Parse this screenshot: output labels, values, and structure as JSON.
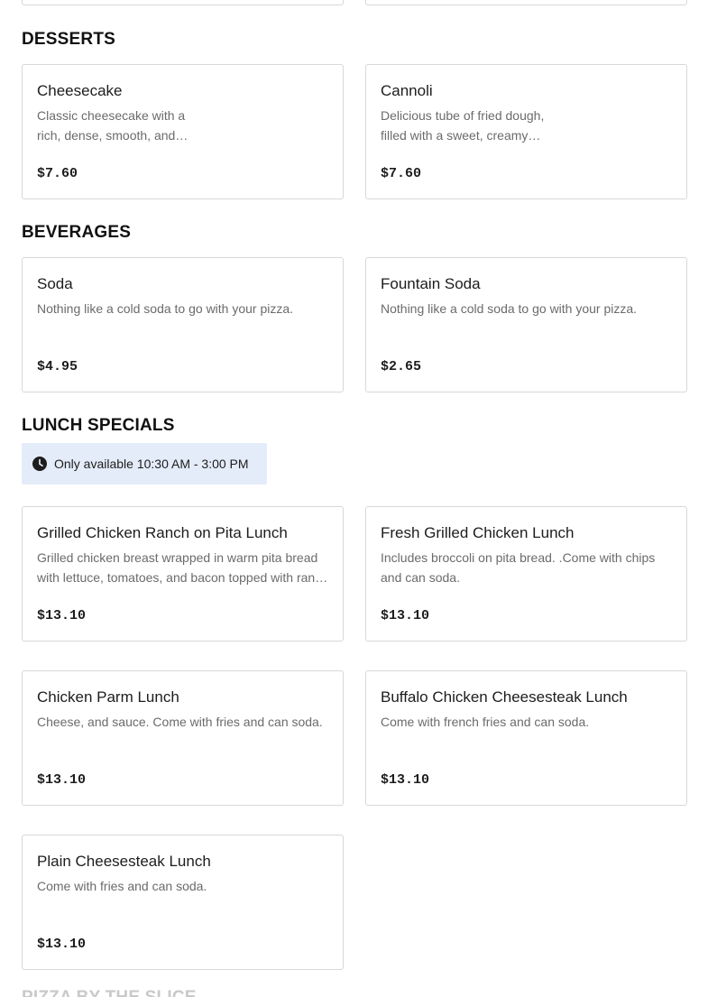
{
  "sections": {
    "desserts": {
      "title": "DESSERTS",
      "items": [
        {
          "name": "Cheesecake",
          "description": "Classic cheesecake with a rich, dense, smooth, and creamy consistency.",
          "price": "$7.60"
        },
        {
          "name": "Cannoli",
          "description": "Delicious tube of fried dough, filled with a sweet, creamy ricotta filling.",
          "price": "$7.60"
        }
      ]
    },
    "beverages": {
      "title": "BEVERAGES",
      "items": [
        {
          "name": "Soda",
          "description": "Nothing like a cold soda to go with your pizza.",
          "price": "$4.95"
        },
        {
          "name": "Fountain Soda",
          "description": "Nothing like a cold soda to go with your pizza.",
          "price": "$2.65"
        }
      ]
    },
    "lunch_specials": {
      "title": "LUNCH SPECIALS",
      "availability": "Only available 10:30 AM - 3:00 PM",
      "items": [
        {
          "name": "Grilled Chicken Ranch on Pita Lunch",
          "description": "Grilled chicken breast wrapped in warm pita bread with lettuce, tomatoes, and bacon topped with ranch dressing. Come with fries and can soda.",
          "price": "$13.10"
        },
        {
          "name": "Fresh Grilled Chicken Lunch",
          "description": "Includes broccoli on pita bread. .Come with chips and can soda.",
          "price": "$13.10"
        },
        {
          "name": "Chicken Parm Lunch",
          "description": "Cheese, and sauce. Come with fries and can soda.",
          "price": "$13.10"
        },
        {
          "name": "Buffalo Chicken Cheesesteak Lunch",
          "description": "Come with french fries and can soda.",
          "price": "$13.10"
        },
        {
          "name": "Plain Cheesesteak Lunch",
          "description": "Come with fries and can soda.",
          "price": "$13.10"
        }
      ]
    },
    "next_section": {
      "title": "PIZZA BY THE SLICE"
    }
  },
  "icons": {
    "availability_icon": "clock-icon"
  },
  "colors": {
    "notice_background": "#e4ecf9",
    "card_border": "#d8d8d8",
    "description_text": "#6b6b6b"
  }
}
